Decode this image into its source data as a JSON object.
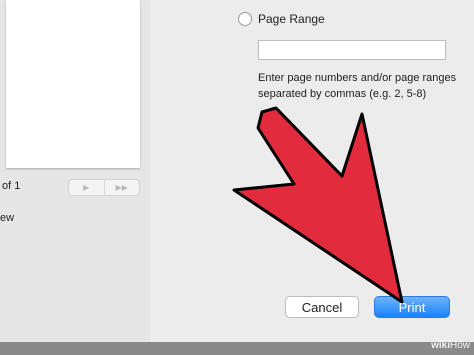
{
  "preview": {
    "page_count": "of 1",
    "nav_prev_icon": "▶",
    "nav_next_icon": "▶▶",
    "detail_text": "ew"
  },
  "page_range": {
    "label": "Page Range",
    "selected": false,
    "input_value": "",
    "help_text": "Enter page numbers and/or page ranges separated by commas (e.g. 2, 5-8)"
  },
  "buttons": {
    "cancel_label": "Cancel",
    "print_label": "Print"
  },
  "overlay": {
    "arrow_color": "#e22b3c"
  },
  "watermark": {
    "brand": "wiki",
    "brand_suffix": "How"
  }
}
